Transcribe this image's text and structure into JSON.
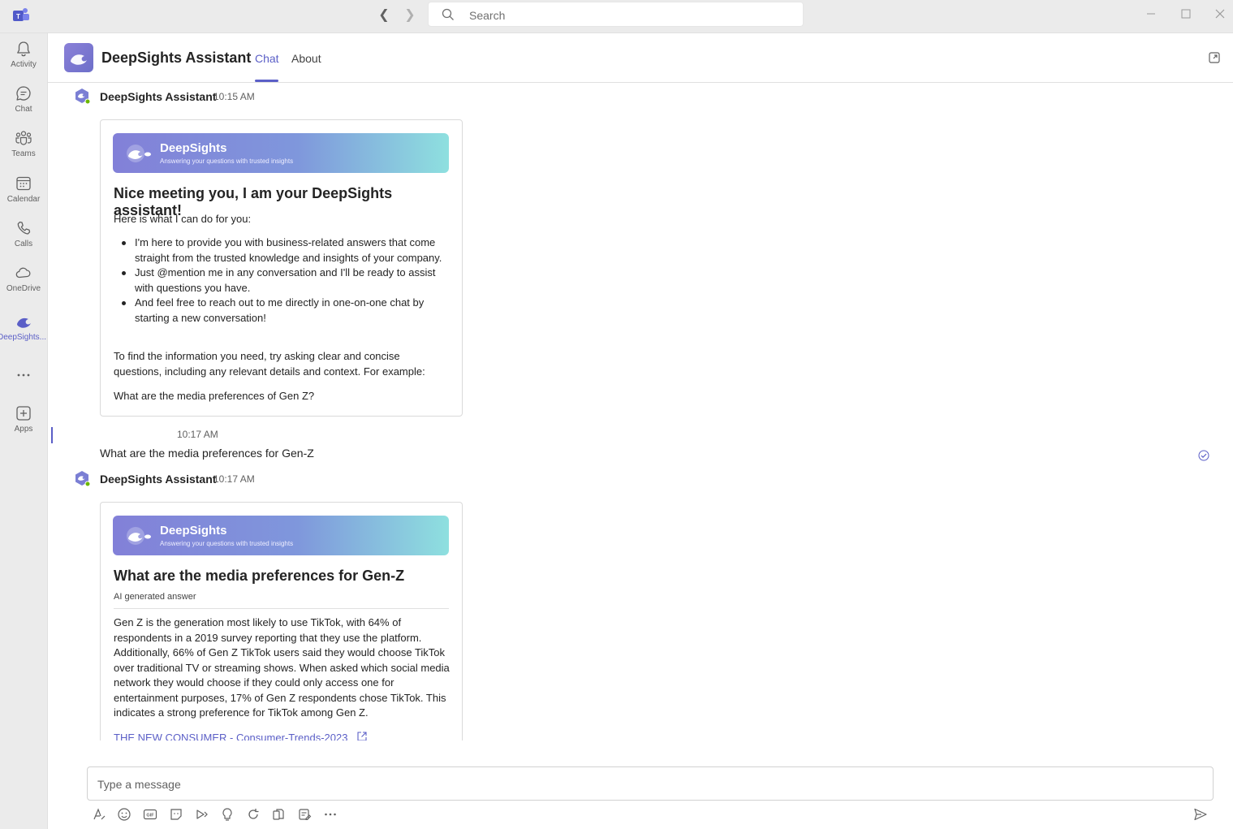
{
  "window": {
    "search_placeholder": "Search"
  },
  "rail": {
    "items": [
      {
        "label": "Activity",
        "icon": "bell-icon"
      },
      {
        "label": "Chat",
        "icon": "chat-icon"
      },
      {
        "label": "Teams",
        "icon": "teams-icon"
      },
      {
        "label": "Calendar",
        "icon": "calendar-icon"
      },
      {
        "label": "Calls",
        "icon": "phone-icon"
      },
      {
        "label": "OneDrive",
        "icon": "cloud-icon"
      },
      {
        "label": "DeepSights...",
        "icon": "deepsights-icon"
      },
      {
        "label": "",
        "icon": "more-icon"
      },
      {
        "label": "Apps",
        "icon": "add-app-icon"
      }
    ]
  },
  "header": {
    "title": "DeepSights Assistant",
    "tabs": [
      {
        "label": "Chat",
        "active": true
      },
      {
        "label": "About",
        "active": false
      }
    ]
  },
  "messages": {
    "m1": {
      "sender": "DeepSights Assistant",
      "time": "10:15 AM",
      "banner_title": "DeepSights",
      "banner_subtitle": "Answering your questions with trusted insights",
      "heading": "Nice meeting you, I am your DeepSights assistant!",
      "intro": "Here is what I can do for you:",
      "bullets": [
        "I'm here to provide you with business-related answers that come straight from the trusted knowledge and insights of your company.",
        "Just @mention me in any conversation and I'll be ready to assist with questions you have.",
        "And feel free to reach out to me directly in one-on-one chat by starting a new conversation!"
      ],
      "tip": "To find the information you need, try asking clear and concise questions, including any relevant details and context. For example:",
      "example": "What are the media preferences of Gen Z?"
    },
    "m2": {
      "time": "10:17 AM",
      "text": "What are the media preferences for Gen-Z"
    },
    "m3": {
      "sender": "DeepSights Assistant",
      "time": "10:17 AM",
      "banner_title": "DeepSights",
      "banner_subtitle": "Answering your questions with trusted insights",
      "heading": "What are the media preferences for Gen-Z",
      "label": "AI generated answer",
      "answer": "Gen Z is the generation most likely to use TikTok, with 64% of respondents in a 2019 survey reporting that they use the platform. Additionally, 66% of Gen Z TikTok users said they would choose TikTok over traditional TV or streaming shows. When asked which social media network they would choose if they could only access one for entertainment purposes, 17% of Gen Z respondents chose TikTok. This indicates a strong preference for TikTok among Gen Z.",
      "source_link": "THE NEW CONSUMER - Consumer-Trends-2023"
    }
  },
  "compose": {
    "placeholder": "Type a message"
  },
  "colors": {
    "accent": "#5b5fc7",
    "rail_bg": "#ebebeb"
  }
}
